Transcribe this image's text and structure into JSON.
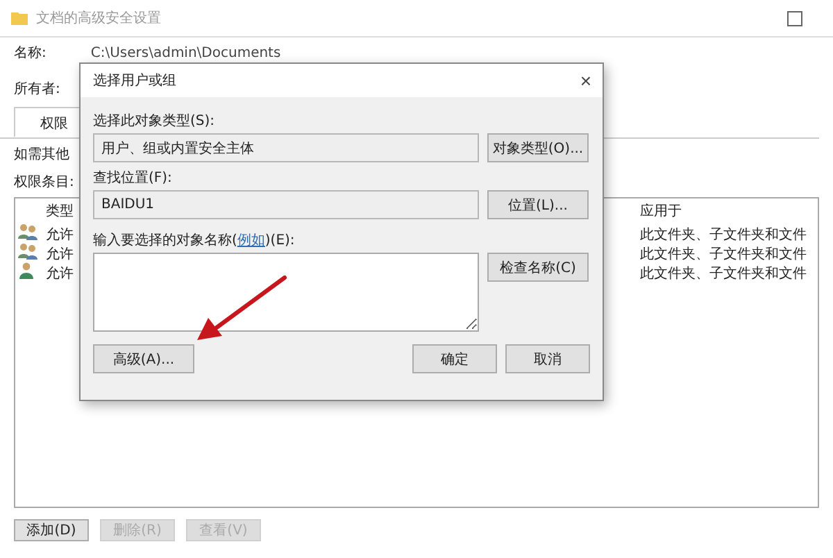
{
  "window": {
    "title": "文档的高级安全设置",
    "name_label": "名称:",
    "path": "C:\\Users\\admin\\Documents",
    "owner_label": "所有者:",
    "tabs": [
      {
        "label": "权限",
        "selected": true
      }
    ],
    "hint": "如需其他",
    "entries_label": "权限条目:",
    "table": {
      "columns": [
        "类型",
        "应用于"
      ],
      "rows": [
        {
          "kind": "group",
          "type": "允许",
          "applies_to": "此文件夹、子文件夹和文件"
        },
        {
          "kind": "group",
          "type": "允许",
          "applies_to": "此文件夹、子文件夹和文件"
        },
        {
          "kind": "user",
          "type": "允许",
          "applies_to": "此文件夹、子文件夹和文件"
        }
      ]
    },
    "buttons": [
      {
        "label": "添加(D)",
        "disabled": false
      },
      {
        "label": "删除(R)",
        "disabled": true
      },
      {
        "label": "查看(V)",
        "disabled": true
      }
    ]
  },
  "dialog": {
    "title": "选择用户或组",
    "close": "×",
    "type_label": "选择此对象类型(S):",
    "type_value": "用户、组或内置安全主体",
    "type_button": "对象类型(O)...",
    "location_label": "查找位置(F):",
    "location_value": "BAIDU1",
    "location_button": "位置(L)...",
    "names_label_before": "输入要选择的对象名称(",
    "names_link": "例如",
    "names_label_after": ")(E):",
    "check_button": "检查名称(C)",
    "advanced_button": "高级(A)...",
    "ok_button": "确定",
    "cancel_button": "取消"
  }
}
